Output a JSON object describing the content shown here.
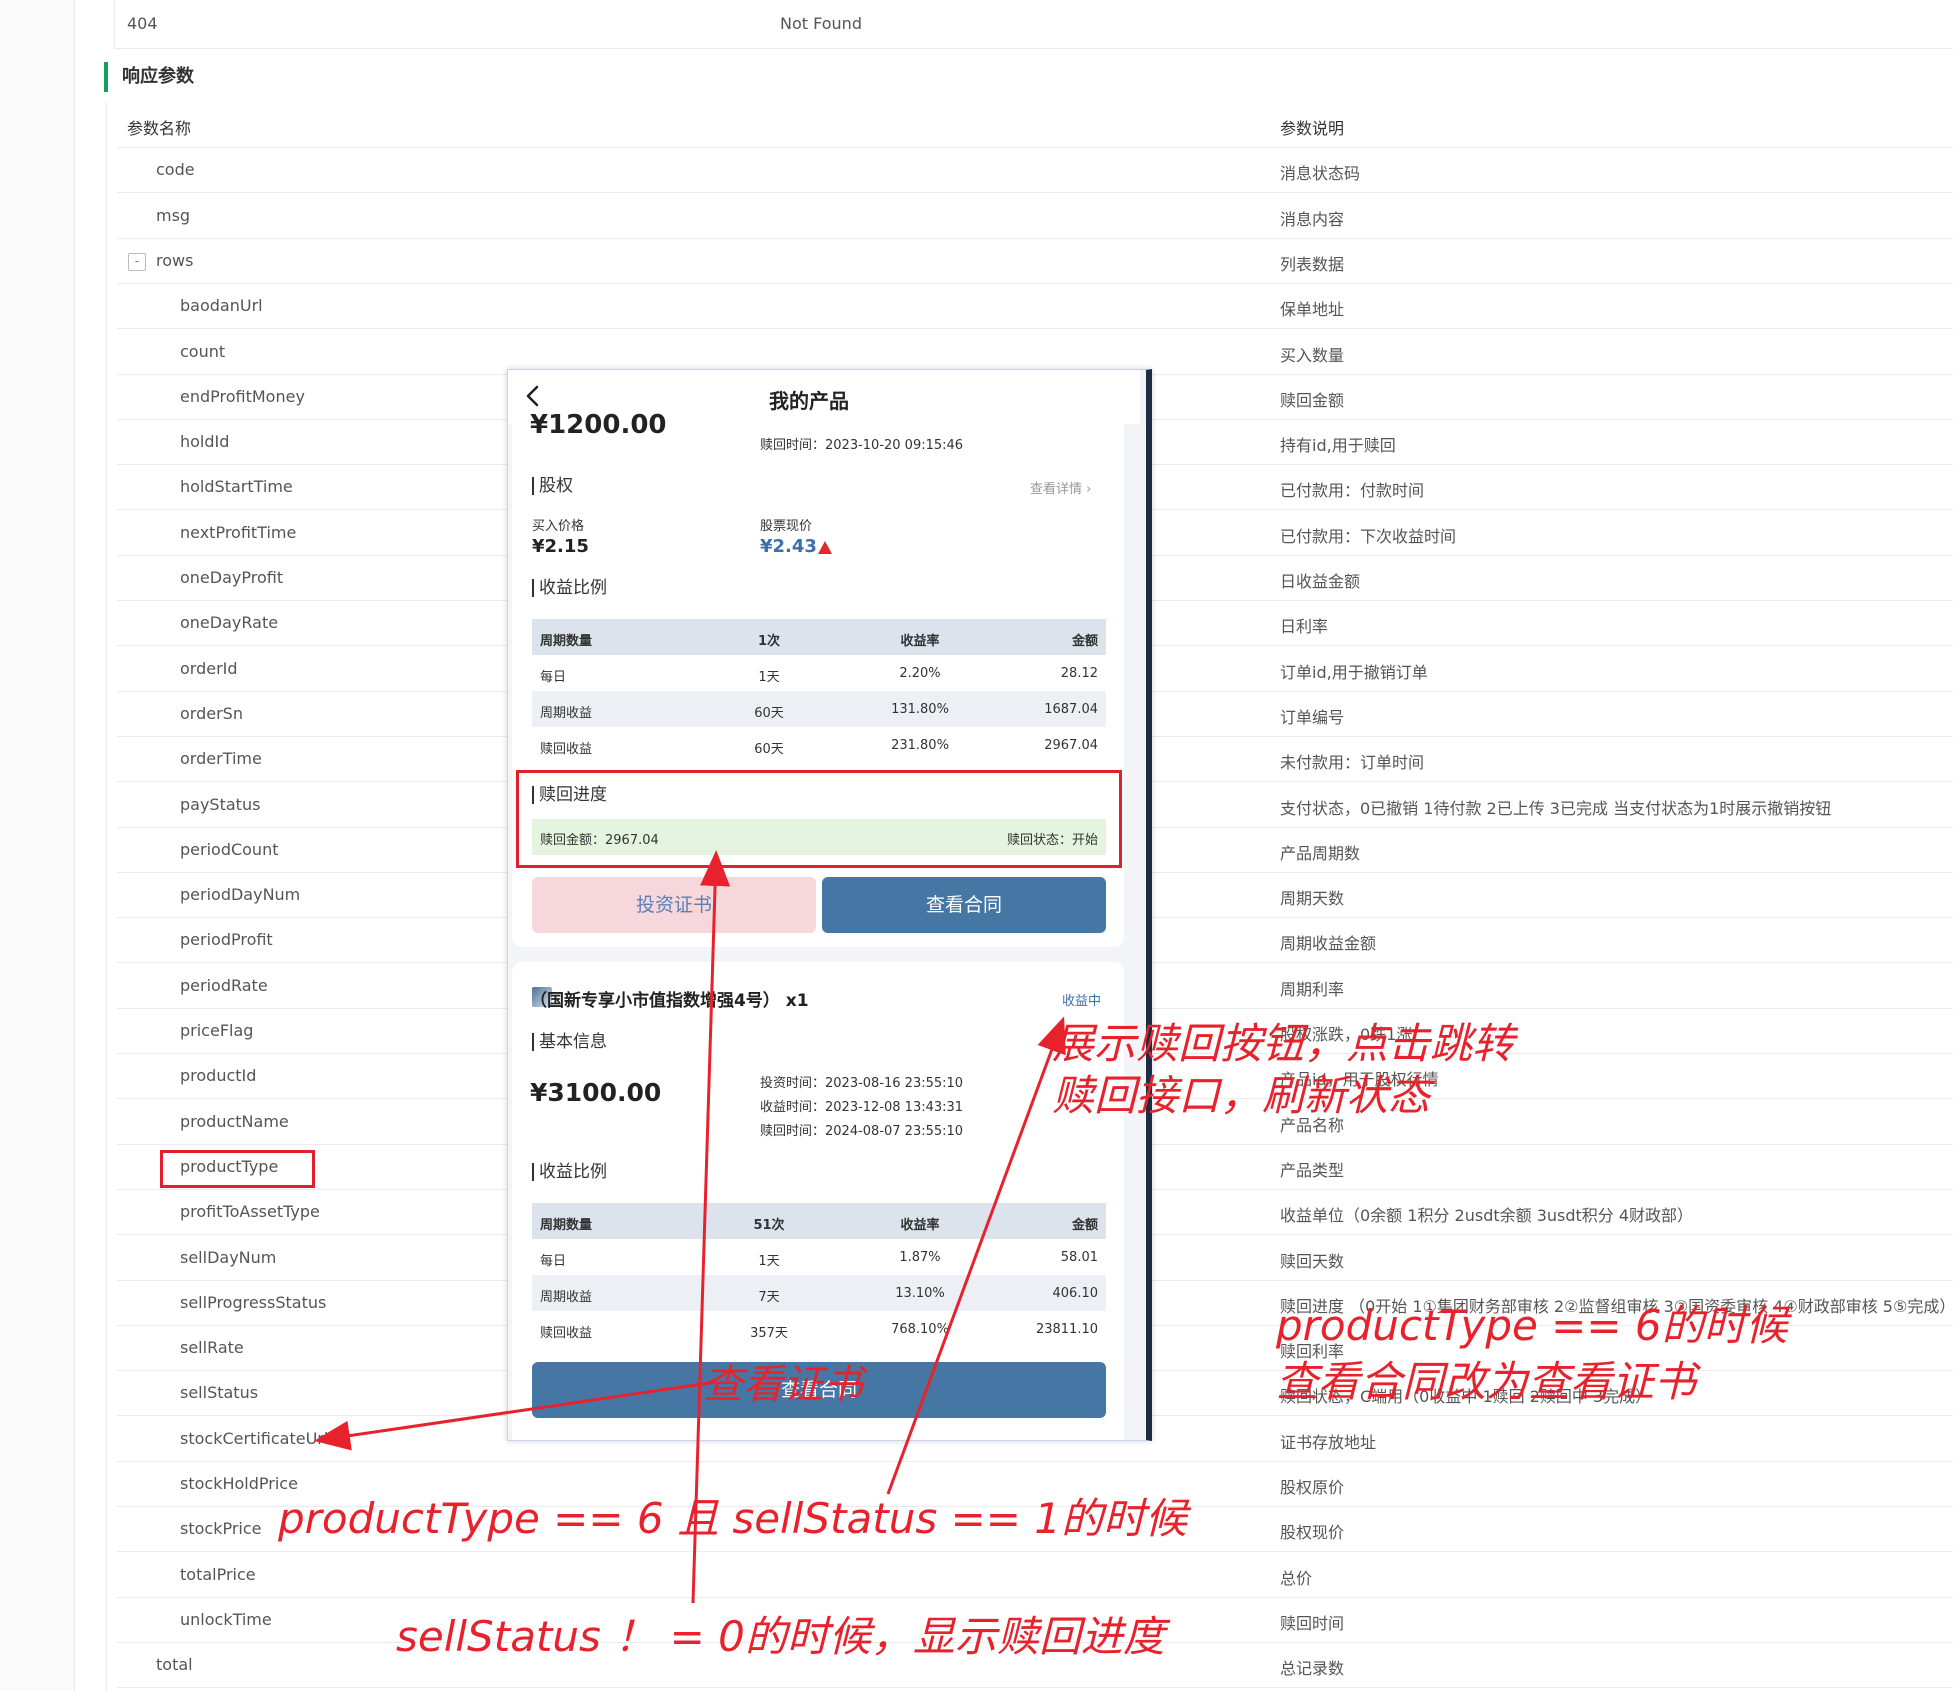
{
  "status_row": {
    "code": "404",
    "text": "Not Found"
  },
  "section_title": "响应参数",
  "table": {
    "header": {
      "name": "参数名称",
      "desc": "参数说明"
    },
    "rows": [
      {
        "name": "code",
        "desc": "消息状态码"
      },
      {
        "name": "msg",
        "desc": "消息内容"
      },
      {
        "name": "rows",
        "desc": "列表数据",
        "toggle": "-"
      },
      {
        "name": "baodanUrl",
        "desc": "保单地址"
      },
      {
        "name": "count",
        "desc": "买入数量"
      },
      {
        "name": "endProfitMoney",
        "desc": "赎回金额"
      },
      {
        "name": "holdId",
        "desc": "持有id,用于赎回"
      },
      {
        "name": "holdStartTime",
        "desc": "已付款用：付款时间"
      },
      {
        "name": "nextProfitTime",
        "desc": "已付款用：下次收益时间"
      },
      {
        "name": "oneDayProfit",
        "desc": "日收益金额"
      },
      {
        "name": "oneDayRate",
        "desc": "日利率"
      },
      {
        "name": "orderId",
        "desc": "订单id,用于撤销订单"
      },
      {
        "name": "orderSn",
        "desc": "订单编号"
      },
      {
        "name": "orderTime",
        "desc": "未付款用：订单时间"
      },
      {
        "name": "payStatus",
        "desc": "支付状态，0已撤销 1待付款 2已上传 3已完成 当支付状态为1时展示撤销按钮"
      },
      {
        "name": "periodCount",
        "desc": "产品周期数"
      },
      {
        "name": "periodDayNum",
        "desc": "周期天数"
      },
      {
        "name": "periodProfit",
        "desc": "周期收益金额"
      },
      {
        "name": "periodRate",
        "desc": "周期利率"
      },
      {
        "name": "priceFlag",
        "desc": "股权涨跌，0跌1涨"
      },
      {
        "name": "productId",
        "desc": "产品id，用于股权行情"
      },
      {
        "name": "productName",
        "desc": "产品名称"
      },
      {
        "name": "productType",
        "desc": "产品类型"
      },
      {
        "name": "profitToAssetType",
        "desc": "收益单位（0余额 1积分 2usdt余额 3usdt积分 4财政部）"
      },
      {
        "name": "sellDayNum",
        "desc": "赎回天数"
      },
      {
        "name": "sellProgressStatus",
        "desc": "赎回进度 （0开始 1①集团财务部审核 2②监督组审核 3③国资委审核 4④财政部审核 5⑤完成）"
      },
      {
        "name": "sellRate",
        "desc": "赎回利率"
      },
      {
        "name": "sellStatus",
        "desc": "赎回状态，C端用（0收益中 1赎回 2赎回中 3完成）"
      },
      {
        "name": "stockCertificateUrl",
        "desc": "证书存放地址"
      },
      {
        "name": "stockHoldPrice",
        "desc": "股权原价"
      },
      {
        "name": "stockPrice",
        "desc": "股权现价"
      },
      {
        "name": "totalPrice",
        "desc": "总价"
      },
      {
        "name": "unlockTime",
        "desc": "赎回时间"
      },
      {
        "name": "total",
        "desc": "总记录数"
      }
    ]
  },
  "phone": {
    "title": "我的产品",
    "card1": {
      "partial_amount": "¥1200.00",
      "redeem_time": "赎回时间：2023-10-20 09:15:46",
      "equity_title": "股权",
      "view_detail": "查看详情 ›",
      "buy_price_label": "买入价格",
      "buy_price": "¥2.15",
      "current_price_label": "股票现价",
      "current_price": "¥2.43",
      "profit_title": "收益比例",
      "table": {
        "header": [
          "周期数量",
          "1次",
          "收益率",
          "金额"
        ],
        "rows": [
          [
            "每日",
            "1天",
            "2.20%",
            "28.12"
          ],
          [
            "周期收益",
            "60天",
            "131.80%",
            "1687.04"
          ],
          [
            "赎回收益",
            "60天",
            "231.80%",
            "2967.04"
          ]
        ]
      },
      "progress_title": "赎回进度",
      "redeem_amount": "赎回金额：2967.04",
      "redeem_status": "赎回状态：开始",
      "btn_certificate": "投资证书",
      "btn_contract": "查看合同"
    },
    "card2": {
      "name": "（国新专享小市值指数增强4号） x1",
      "status": "收益中",
      "basic_title": "基本信息",
      "amount": "¥3100.00",
      "invest_time": "投资时间：2023-08-16 23:55:10",
      "profit_time": "收益时间：2023-12-08 13:43:31",
      "redeem_time": "赎回时间：2024-08-07 23:55:10",
      "profit_title": "收益比例",
      "table": {
        "header": [
          "周期数量",
          "51次",
          "收益率",
          "金额"
        ],
        "rows": [
          [
            "每日",
            "1天",
            "1.87%",
            "58.01"
          ],
          [
            "周期收益",
            "7天",
            "13.10%",
            "406.10"
          ],
          [
            "赎回收益",
            "357天",
            "768.10%",
            "23811.10"
          ]
        ]
      },
      "btn_contract": "查看合同"
    }
  },
  "annotations": {
    "redeem_btn_line1": "展示赎回按钮，点击跳转",
    "redeem_btn_line2": "赎回接口，刷新状态",
    "certificate": "查看证书",
    "product_type6_line1": "productType == 6的时候",
    "product_type6_line2": "查看合同改为查看证书",
    "type6_and_sell1": "productType == 6 且 sellStatus == 1的时候",
    "sell_not_zero": "sellStatus ！ = 0的时候，显示赎回进度"
  },
  "colors": {
    "accent_green": "#13a05d",
    "annotation_red": "#e8222d",
    "button_blue": "#4676a4",
    "button_pink": "#f5d7dc"
  }
}
